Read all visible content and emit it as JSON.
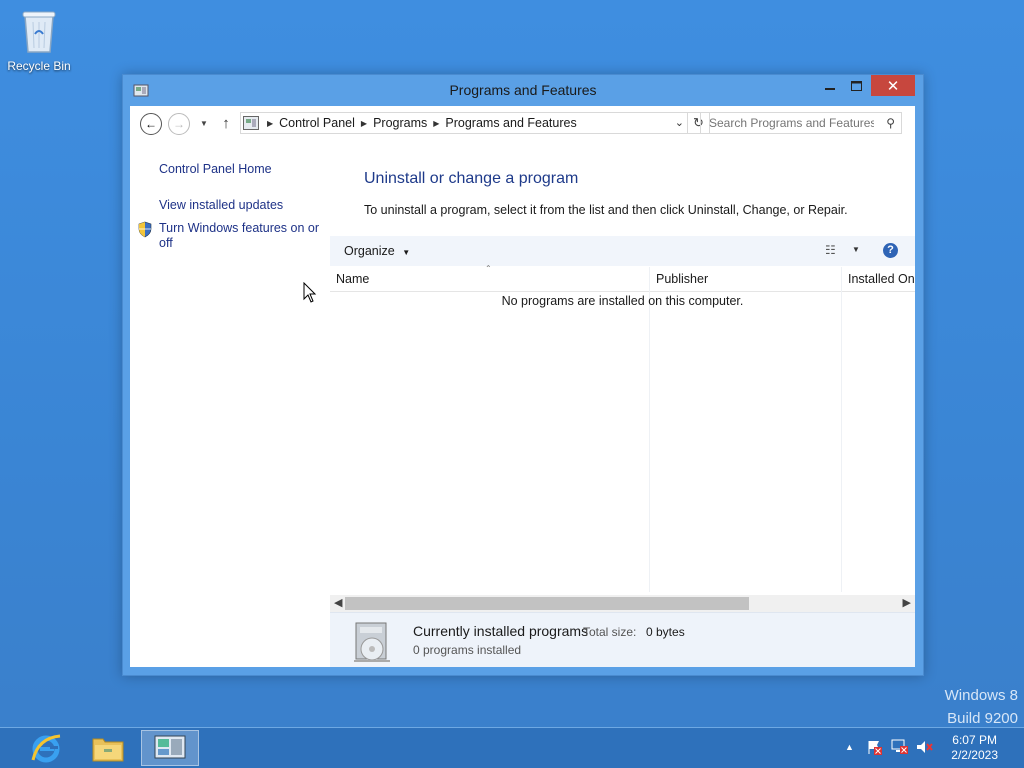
{
  "desktop": {
    "recycle_bin_label": "Recycle Bin"
  },
  "window": {
    "title": "Programs and Features",
    "address": {
      "crumbs": [
        "Control Panel",
        "Programs",
        "Programs and Features"
      ]
    },
    "search": {
      "placeholder": "Search Programs and Features"
    },
    "left_pane": {
      "home": "Control Panel Home",
      "updates": "View installed updates",
      "features_line1": "Turn Windows features on or",
      "features_line2": "off"
    },
    "main": {
      "heading": "Uninstall or change a program",
      "description": "To uninstall a program, select it from the list and then click Uninstall, Change, or Repair.",
      "organize_label": "Organize",
      "columns": [
        "Name",
        "Publisher",
        "Installed On"
      ],
      "empty_message": "No programs are installed on this computer."
    },
    "details": {
      "title": "Currently installed programs",
      "total_size_label": "Total size:",
      "total_size_value": "0 bytes",
      "count_text": "0 programs installed"
    }
  },
  "watermark": {
    "line1": "Windows 8",
    "line2": "Build 9200"
  },
  "taskbar": {
    "items": [
      "internet-explorer",
      "file-explorer",
      "control-panel"
    ],
    "clock_time": "6:07 PM",
    "clock_date": "2/2/2023"
  },
  "colors": {
    "accent": "#5aa0e6",
    "close": "#c7473e",
    "link": "#1e3287"
  }
}
